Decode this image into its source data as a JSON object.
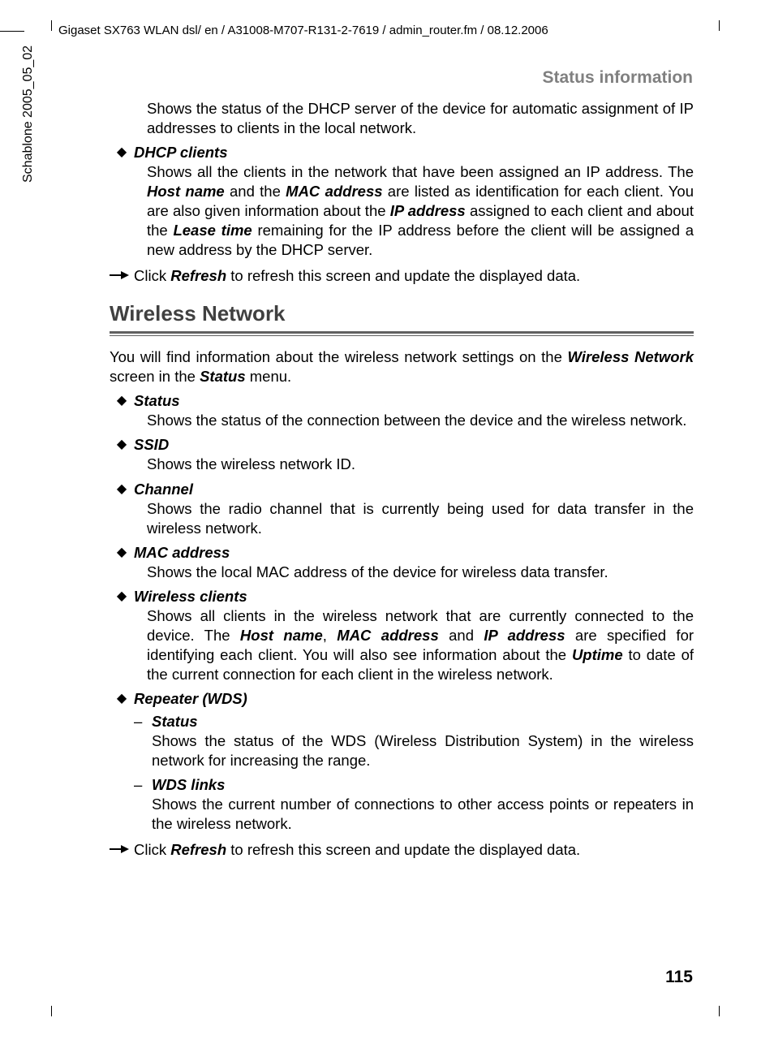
{
  "header": "Gigaset SX763 WLAN dsl/ en / A31008-M707-R131-2-7619 / admin_router.fm / 08.12.2006",
  "side_label": "Schablone 2005_05_02",
  "section_header": "Status information",
  "page_number": "115",
  "intro_para": "Shows the status of the DHCP server of the device for automatic assignment of IP addresses to clients in the local network.",
  "dhcp_clients": {
    "title": "DHCP clients",
    "p1a": "Shows all the clients in the network that have been assigned an IP address. The ",
    "p1_host": "Host name",
    "p1b": " and the ",
    "p1_mac": "MAC address",
    "p1c": " are listed as identification for each client. You are also given information about the ",
    "p1_ip": "IP address",
    "p1d": " assigned to each client and about the ",
    "p1_lease": "Lease time",
    "p1e": " remaining for the IP address before the client will be assigned a new address by the DHCP server."
  },
  "refresh": {
    "pre": "Click ",
    "word": "Refresh",
    "post": " to refresh this screen and update the displayed data."
  },
  "wireless": {
    "heading": "Wireless Network",
    "intro_a": "You will find information about the wireless network settings on the ",
    "intro_wn": "Wireless Network",
    "intro_b": " screen in the ",
    "intro_status": "Status",
    "intro_c": " menu.",
    "items": [
      {
        "title": "Status",
        "body": "Shows the status of the connection between the device and the wireless network."
      },
      {
        "title": "SSID",
        "body": "Shows the wireless network ID."
      },
      {
        "title": "Channel",
        "body": "Shows the radio channel that is currently being used for data transfer in the wireless network."
      },
      {
        "title": "MAC address",
        "body": "Shows the local MAC address of the device for wireless data transfer."
      }
    ],
    "wc": {
      "title": "Wireless clients",
      "a": "Shows all clients in the wireless network that are currently connected to the device. The ",
      "host": "Host name",
      "b": ", ",
      "mac": "MAC address",
      "c": " and ",
      "ip": "IP address",
      "d": " are specified for identifying each client. You will also see information about the ",
      "uptime": "Uptime",
      "e": " to date of the current connection for each client in the wireless network."
    },
    "repeater": {
      "title": "Repeater (WDS)",
      "sub": [
        {
          "title": "Status",
          "body": "Shows the status of the WDS (Wireless Distribution System) in the wireless network for increasing the range."
        },
        {
          "title": "WDS links",
          "body": "Shows the current number of connections to other access points or repeaters in the wireless network."
        }
      ]
    }
  }
}
